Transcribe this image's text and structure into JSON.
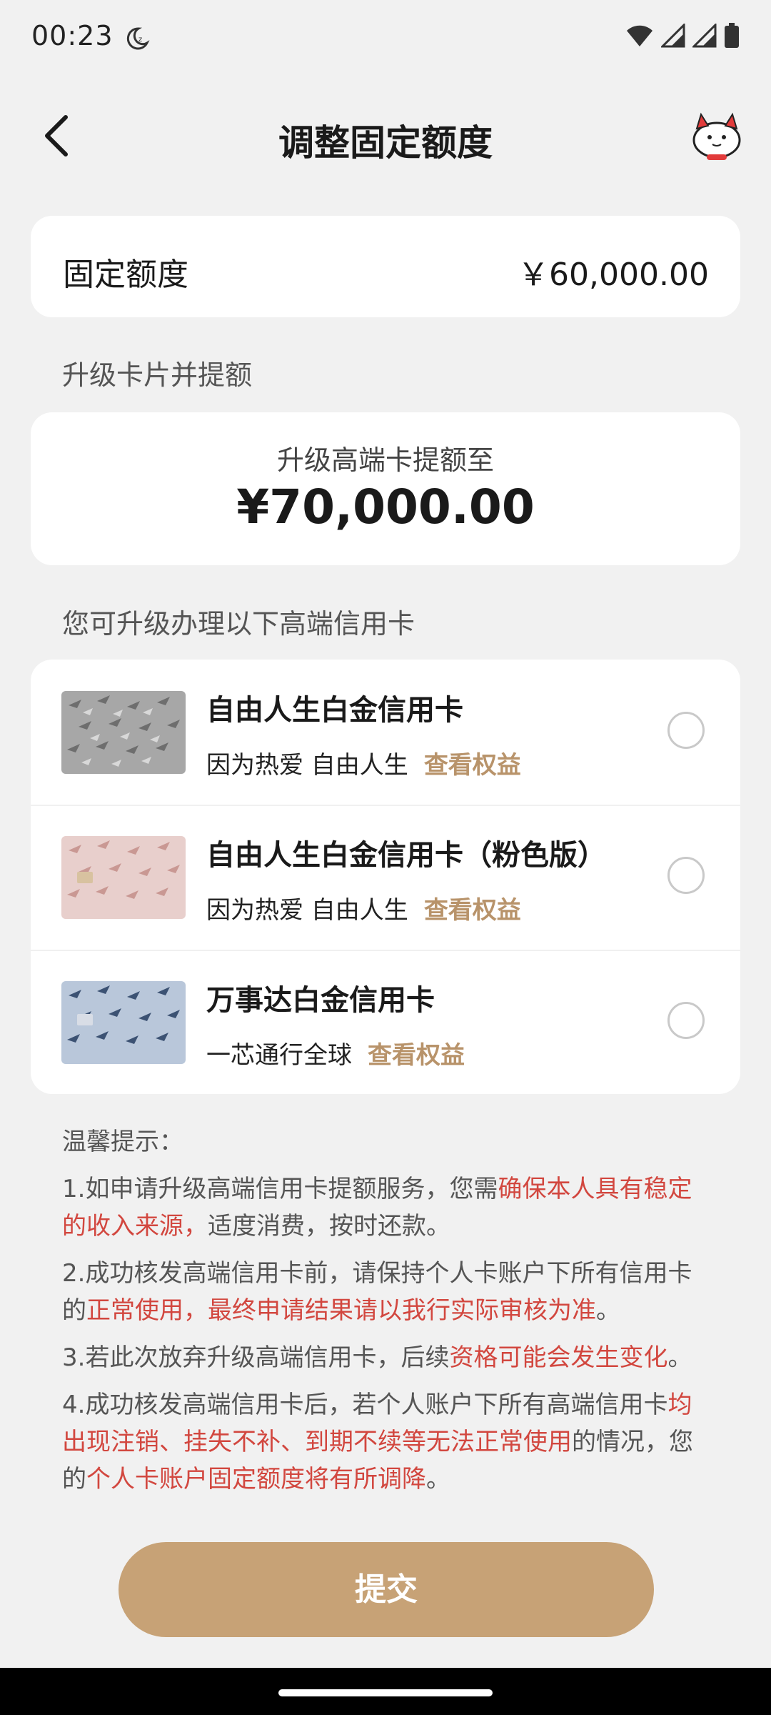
{
  "status": {
    "time": "00:23"
  },
  "header": {
    "title": "调整固定额度"
  },
  "fixed_limit": {
    "label": "固定额度",
    "value": "￥60,000.00"
  },
  "upgrade": {
    "section_label": "升级卡片并提额",
    "subtitle": "升级高端卡提额至",
    "amount": "¥70,000.00"
  },
  "cards": {
    "section_label": "您可升级办理以下高端信用卡",
    "items": [
      {
        "name": "自由人生白金信用卡",
        "desc": "因为热爱 自由人生",
        "link": "查看权益"
      },
      {
        "name": "自由人生白金信用卡（粉色版）",
        "desc": "因为热爱 自由人生",
        "link": "查看权益"
      },
      {
        "name": "万事达白金信用卡",
        "desc": "一芯通行全球",
        "link": "查看权益"
      }
    ]
  },
  "tips": {
    "title": "温馨提示：",
    "t1a": "1.如申请升级高端信用卡提额服务，您需",
    "t1b": "确保本人具有稳定的收入来源，",
    "t1c": "适度消费，按时还款。",
    "t2a": "2.成功核发高端信用卡前，请保持个人卡账户下所有信用卡的",
    "t2b": "正常使用，最终申请结果请以我行实际审核为准",
    "t2c": "。",
    "t3a": "3.若此次放弃升级高端信用卡，后续",
    "t3b": "资格可能会发生变化",
    "t3c": "。",
    "t4a": "4.成功核发高端信用卡后，若个人账户下所有高端信用卡",
    "t4b": "均出现注销、挂失不补、到期不续等无法正常使用",
    "t4c": "的情况，您的",
    "t4d": "个人卡账户固定额度将有所调降",
    "t4e": "。"
  },
  "submit": {
    "label": "提交"
  },
  "colors": {
    "accent": "#c7a276",
    "link": "#b8936a",
    "warning": "#d2473f"
  }
}
